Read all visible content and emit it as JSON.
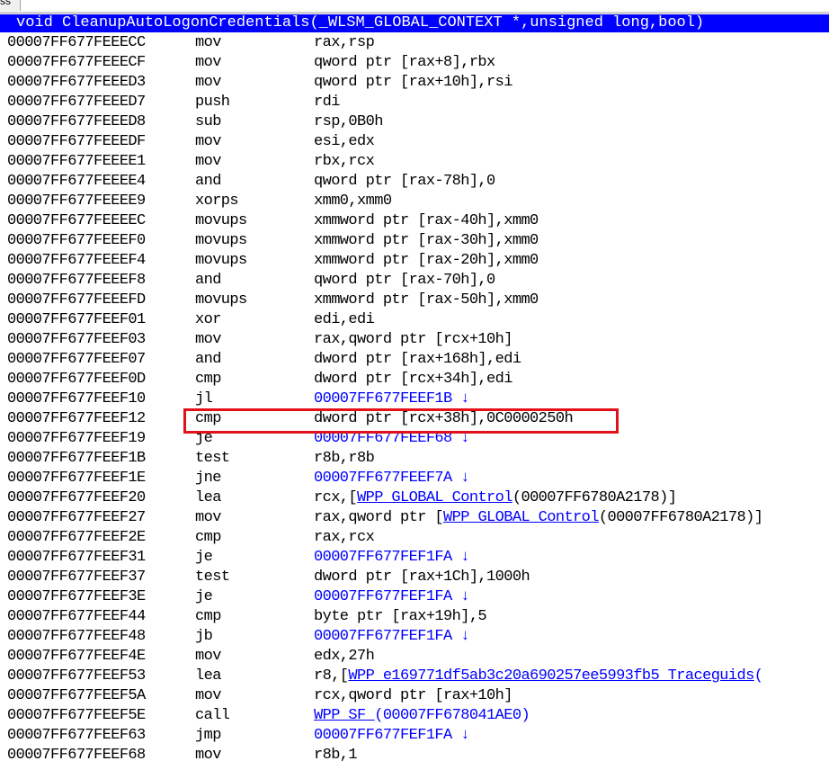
{
  "address_bar": {
    "label": "ss",
    "value": ""
  },
  "function_header": "void CleanupAutoLogonCredentials(_WLSM_GLOBAL_CONTEXT *,unsigned long,bool)",
  "highlight_color": "#e0111a",
  "header_color": "#0000ff",
  "link_color": "#0000ff",
  "rows": [
    {
      "addr": "00007FF677FEEECC",
      "mn": "mov",
      "op": [
        {
          "t": "rax,rsp"
        }
      ]
    },
    {
      "addr": "00007FF677FEEECF",
      "mn": "mov",
      "op": [
        {
          "t": "qword ptr [rax+8],rbx"
        }
      ]
    },
    {
      "addr": "00007FF677FEEED3",
      "mn": "mov",
      "op": [
        {
          "t": "qword ptr [rax+10h],rsi"
        }
      ]
    },
    {
      "addr": "00007FF677FEEED7",
      "mn": "push",
      "op": [
        {
          "t": "rdi"
        }
      ]
    },
    {
      "addr": "00007FF677FEEED8",
      "mn": "sub",
      "op": [
        {
          "t": "rsp,0B0h"
        }
      ]
    },
    {
      "addr": "00007FF677FEEEDF",
      "mn": "mov",
      "op": [
        {
          "t": "esi,edx"
        }
      ]
    },
    {
      "addr": "00007FF677FEEEE1",
      "mn": "mov",
      "op": [
        {
          "t": "rbx,rcx"
        }
      ]
    },
    {
      "addr": "00007FF677FEEEE4",
      "mn": "and",
      "op": [
        {
          "t": "qword ptr [rax-78h],0"
        }
      ]
    },
    {
      "addr": "00007FF677FEEEE9",
      "mn": "xorps",
      "op": [
        {
          "t": "xmm0,xmm0"
        }
      ]
    },
    {
      "addr": "00007FF677FEEEEC",
      "mn": "movups",
      "op": [
        {
          "t": "xmmword ptr [rax-40h],xmm0"
        }
      ]
    },
    {
      "addr": "00007FF677FEEEF0",
      "mn": "movups",
      "op": [
        {
          "t": "xmmword ptr [rax-30h],xmm0"
        }
      ]
    },
    {
      "addr": "00007FF677FEEEF4",
      "mn": "movups",
      "op": [
        {
          "t": "xmmword ptr [rax-20h],xmm0"
        }
      ]
    },
    {
      "addr": "00007FF677FEEEF8",
      "mn": "and",
      "op": [
        {
          "t": "qword ptr [rax-70h],0"
        }
      ]
    },
    {
      "addr": "00007FF677FEEEFD",
      "mn": "movups",
      "op": [
        {
          "t": "xmmword ptr [rax-50h],xmm0"
        }
      ]
    },
    {
      "addr": "00007FF677FEEF01",
      "mn": "xor",
      "op": [
        {
          "t": "edi,edi"
        }
      ]
    },
    {
      "addr": "00007FF677FEEF03",
      "mn": "mov",
      "op": [
        {
          "t": "rax,qword ptr [rcx+10h]"
        }
      ]
    },
    {
      "addr": "00007FF677FEEF07",
      "mn": "and",
      "op": [
        {
          "t": "dword ptr [rax+168h],edi"
        }
      ]
    },
    {
      "addr": "00007FF677FEEF0D",
      "mn": "cmp",
      "op": [
        {
          "t": "dword ptr [rcx+34h],edi"
        }
      ]
    },
    {
      "addr": "00007FF677FEEF10",
      "mn": "jl",
      "op": [
        {
          "t": "00007FF677FEEF1B ↓",
          "k": "link"
        }
      ]
    },
    {
      "addr": "00007FF677FEEF12",
      "mn": "cmp",
      "op": [
        {
          "t": "dword ptr [rcx+38h],0C0000250h"
        }
      ],
      "highlighted": true
    },
    {
      "addr": "00007FF677FEEF19",
      "mn": "je",
      "op": [
        {
          "t": "00007FF677FEEF68 ↓",
          "k": "link"
        }
      ]
    },
    {
      "addr": "00007FF677FEEF1B",
      "mn": "test",
      "op": [
        {
          "t": "r8b,r8b"
        }
      ]
    },
    {
      "addr": "00007FF677FEEF1E",
      "mn": "jne",
      "op": [
        {
          "t": "00007FF677FEEF7A ↓",
          "k": "link"
        }
      ]
    },
    {
      "addr": "00007FF677FEEF20",
      "mn": "lea",
      "op": [
        {
          "t": "rcx,["
        },
        {
          "t": "WPP_GLOBAL_Control",
          "k": "sym"
        },
        {
          "t": "(00007FF6780A2178)]"
        }
      ]
    },
    {
      "addr": "00007FF677FEEF27",
      "mn": "mov",
      "op": [
        {
          "t": "rax,qword ptr ["
        },
        {
          "t": "WPP_GLOBAL_Control",
          "k": "sym"
        },
        {
          "t": "(00007FF6780A2178)]"
        }
      ]
    },
    {
      "addr": "00007FF677FEEF2E",
      "mn": "cmp",
      "op": [
        {
          "t": "rax,rcx"
        }
      ]
    },
    {
      "addr": "00007FF677FEEF31",
      "mn": "je",
      "op": [
        {
          "t": "00007FF677FEF1FA ↓",
          "k": "link"
        }
      ]
    },
    {
      "addr": "00007FF677FEEF37",
      "mn": "test",
      "op": [
        {
          "t": "dword ptr [rax+1Ch],1000h"
        }
      ]
    },
    {
      "addr": "00007FF677FEEF3E",
      "mn": "je",
      "op": [
        {
          "t": "00007FF677FEF1FA ↓",
          "k": "link"
        }
      ]
    },
    {
      "addr": "00007FF677FEEF44",
      "mn": "cmp",
      "op": [
        {
          "t": "byte ptr [rax+19h],5"
        }
      ]
    },
    {
      "addr": "00007FF677FEEF48",
      "mn": "jb",
      "op": [
        {
          "t": "00007FF677FEF1FA ↓",
          "k": "link"
        }
      ]
    },
    {
      "addr": "00007FF677FEEF4E",
      "mn": "mov",
      "op": [
        {
          "t": "edx,27h"
        }
      ]
    },
    {
      "addr": "00007FF677FEEF53",
      "mn": "lea",
      "op": [
        {
          "t": "r8,["
        },
        {
          "t": "WPP_e169771df5ab3c20a690257ee5993fb5_Traceguids",
          "k": "sym"
        },
        {
          "t": "(",
          "k": "link"
        }
      ]
    },
    {
      "addr": "00007FF677FEEF5A",
      "mn": "mov",
      "op": [
        {
          "t": "rcx,qword ptr [rax+10h]"
        }
      ]
    },
    {
      "addr": "00007FF677FEEF5E",
      "mn": "call",
      "op": [
        {
          "t": "WPP_SF_",
          "k": "sym"
        },
        {
          "t": "(00007FF678041AE0)",
          "k": "link"
        }
      ]
    },
    {
      "addr": "00007FF677FEEF63",
      "mn": "jmp",
      "op": [
        {
          "t": "00007FF677FEF1FA ↓",
          "k": "link"
        }
      ]
    },
    {
      "addr": "00007FF677FEEF68",
      "mn": "mov",
      "op": [
        {
          "t": "r8b,1"
        }
      ]
    }
  ]
}
